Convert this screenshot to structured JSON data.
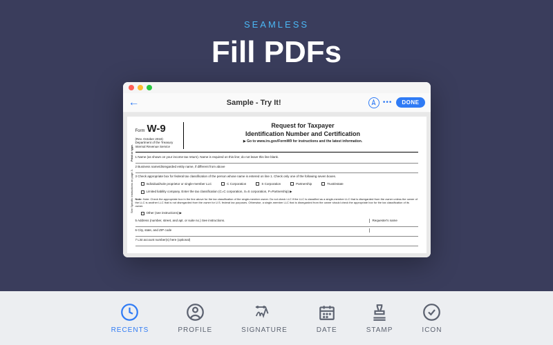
{
  "hero": {
    "eyebrow": "SEAMLESS",
    "headline": "Fill PDFs"
  },
  "window": {
    "doc_title": "Sample - Try It!",
    "done_label": "DONE"
  },
  "form": {
    "form_word": "Form",
    "form_code": "W-9",
    "rev": "(Rev. October 2018)",
    "dept1": "Department of the Treasury",
    "dept2": "Internal Revenue Service",
    "title1": "Request for Taxpayer",
    "title2": "Identification Number and Certification",
    "go": "▶ Go to www.irs.gov/FormW9 for instructions and the latest information.",
    "line1": "1  Name (as shown on your income tax return). Name is required on this line; do not leave this line blank.",
    "line2": "2  Business name/disregarded entity name, if different from above",
    "line3": "3  Check appropriate box for federal tax classification of the person whose name is entered on line 1. Check only one of the following seven boxes.",
    "chk_ind": "Individual/sole proprietor or single-member LLC",
    "chk_c": "C Corporation",
    "chk_s": "S Corporation",
    "chk_p": "Partnership",
    "chk_t": "Trust/estate",
    "llc_line": "Limited liability company. Enter the tax classification (C=C corporation, S=S corporation, P=Partnership) ▶",
    "note": "Note: Check the appropriate box in the line above for the tax classification of the single-member owner. Do not check LLC if the LLC is classified as a single-member LLC that is disregarded from the owner unless the owner of the LLC is another LLC that is not disregarded from the owner for U.S. federal tax purposes. Otherwise, a single-member LLC that is disregarded from the owner should check the appropriate box for the tax classification of its owner.",
    "other": "Other (see instructions) ▶",
    "line5": "5  Address (number, street, and apt. or suite no.) See instructions.",
    "line6": "6  City, state, and ZIP code",
    "line7": "7  List account number(s) here (optional)",
    "requester": "Requester's name",
    "side1": "Print or type.",
    "side2": "See Specific Instructions on page 3."
  },
  "nav": {
    "items": [
      {
        "label": "RECENTS",
        "active": true
      },
      {
        "label": "PROFILE",
        "active": false
      },
      {
        "label": "SIGNATURE",
        "active": false
      },
      {
        "label": "DATE",
        "active": false
      },
      {
        "label": "STAMP",
        "active": false
      },
      {
        "label": "ICON",
        "active": false
      }
    ]
  }
}
